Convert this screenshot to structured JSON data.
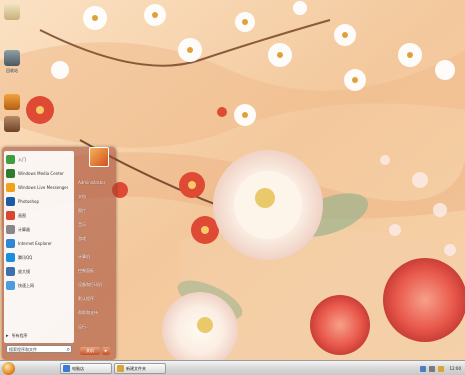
{
  "desktop": {
    "icons": [
      {
        "name": "computer-icon",
        "label": "",
        "color": "#d9c9a0"
      },
      {
        "name": "recycle-bin-icon",
        "label": "回收站",
        "color": "#5b6a72"
      },
      {
        "name": "folder-icon",
        "label": "",
        "color": "#c4741e"
      },
      {
        "name": "app-icon",
        "label": "",
        "color": "#8a5a3a"
      }
    ]
  },
  "start_menu": {
    "programs": [
      {
        "label": "入门",
        "icon": "getting-started-icon",
        "color": "#3f9f3f"
      },
      {
        "label": "Windows Media Center",
        "icon": "media-center-icon",
        "color": "#2f7b2f"
      },
      {
        "label": "Windows Live Messenger",
        "icon": "messenger-icon",
        "color": "#f0a21b"
      },
      {
        "label": "Photoshop",
        "icon": "photoshop-icon",
        "color": "#1b5aa8"
      },
      {
        "label": "画图",
        "icon": "paint-icon",
        "color": "#d8472f"
      },
      {
        "label": "计算器",
        "icon": "calculator-icon",
        "color": "#888888"
      },
      {
        "label": "Internet Explorer",
        "icon": "ie-icon",
        "color": "#2e86d4"
      },
      {
        "label": "腾讯QQ",
        "icon": "qq-icon",
        "color": "#1a8fe0"
      },
      {
        "label": "放大镜",
        "icon": "magnifier-icon",
        "color": "#3a6fb0"
      },
      {
        "label": "快速上网",
        "icon": "network-icon",
        "color": "#4c9be0"
      }
    ],
    "all_programs_label": "所有程序",
    "search_placeholder": "搜索程序和文件",
    "right_items": [
      "Administrator",
      "文档",
      "图片",
      "音乐",
      "游戏",
      "计算机",
      "控制面板",
      "设备和打印机",
      "默认程序",
      "帮助和支持",
      "运行..."
    ],
    "shutdown_label": "关机"
  },
  "taskbar": {
    "buttons": [
      {
        "label": "电脑店",
        "color": "#3a7bd5"
      },
      {
        "label": "新建文件夹",
        "color": "#d9a43a"
      }
    ],
    "clock": "12:00"
  }
}
